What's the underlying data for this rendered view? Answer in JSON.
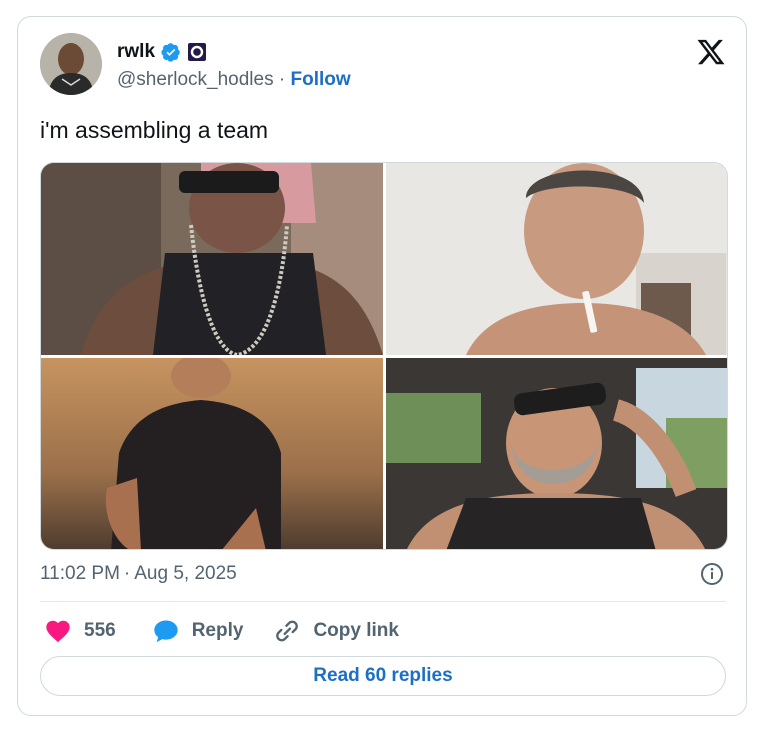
{
  "author": {
    "display_name": "rwlk",
    "handle": "@sherlock_hodles",
    "separator": "·",
    "follow_label": "Follow",
    "verified_color": "#1d9bf0"
  },
  "tweet": {
    "text": "i'm assembling a team",
    "time": "11:02 PM",
    "dot": "·",
    "date": "Aug 5, 2025"
  },
  "media": {
    "images": [
      {
        "icon": "photo-man-sunglasses-chain"
      },
      {
        "icon": "photo-man-cigarette"
      },
      {
        "icon": "photo-man-black-tshirt"
      },
      {
        "icon": "photo-man-car-sunglasses"
      }
    ]
  },
  "actions": {
    "like_count": "556",
    "reply_label": "Reply",
    "copy_label": "Copy link",
    "like_color": "#f91880",
    "reply_color": "#1d9bf0"
  },
  "read_replies_label": "Read 60 replies"
}
